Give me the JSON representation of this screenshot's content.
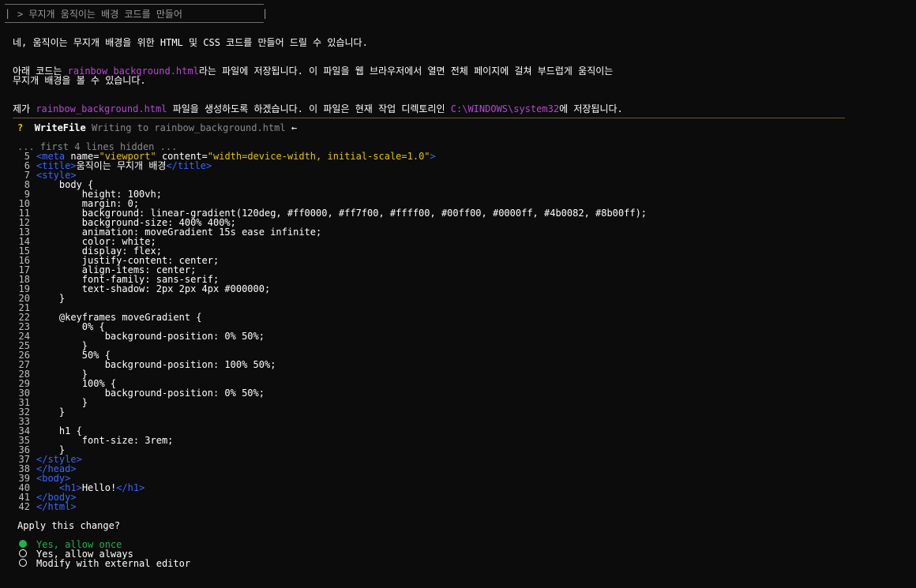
{
  "prompt": {
    "bar_left": "|",
    "text": "> 무지개 움직이는 배경 코드를 만들어",
    "bar_right": "|"
  },
  "messages": {
    "m1": "네, 움직이는 무지개 배경을 위한 HTML 및 CSS 코드를 만들어 드릴 수 있습니다.",
    "m2_pre": "아래 코드는 ",
    "m2_file": "rainbow_background.html",
    "m2_post": "라는 파일에 저장됩니다. 이 파일을 웹 브라우저에서 열면 전체 페이지에 걸쳐 부드럽게 움직이는",
    "m2_line2": "무지개 배경을 볼 수 있습니다.",
    "m3_pre": "제가 ",
    "m3_file": "rainbow_background.html",
    "m3_mid": " 파일을 생성하도록 하겠습니다. 이 파일은 현재 작업 디렉토리인 ",
    "m3_path": "C:\\WINDOWS\\system32",
    "m3_post": "에 저장됩니다."
  },
  "tool": {
    "q": "?",
    "name": "WriteFile",
    "desc": "Writing to rainbow_background.html",
    "arrow": "←"
  },
  "hidden_note": "... first 4 lines hidden ...",
  "code_lines": [
    {
      "n": "5",
      "segs": [
        [
          "tag",
          "<meta"
        ],
        [
          "attr",
          " name="
        ],
        [
          "str",
          "\"viewport\""
        ],
        [
          "attr",
          " content="
        ],
        [
          "str",
          "\"width=device-width, initial-scale=1.0\""
        ],
        [
          "tag",
          ">"
        ]
      ]
    },
    {
      "n": "6",
      "segs": [
        [
          "tag",
          "<title"
        ],
        [
          "tag",
          ">"
        ],
        [
          "text",
          "움직이는 무지개 배경"
        ],
        [
          "tag",
          "</title"
        ],
        [
          "tag",
          ">"
        ]
      ]
    },
    {
      "n": "7",
      "segs": [
        [
          "tag",
          "<style"
        ],
        [
          "tag",
          ">"
        ]
      ]
    },
    {
      "n": "8",
      "segs": [
        [
          "text",
          "    body {"
        ]
      ]
    },
    {
      "n": "9",
      "segs": [
        [
          "text",
          "        height: 100vh;"
        ]
      ]
    },
    {
      "n": "10",
      "segs": [
        [
          "text",
          "        margin: 0;"
        ]
      ]
    },
    {
      "n": "11",
      "segs": [
        [
          "text",
          "        background: linear-gradient(120deg, #ff0000, #ff7f00, #ffff00, #00ff00, #0000ff, #4b0082, #8b00ff);"
        ]
      ]
    },
    {
      "n": "12",
      "segs": [
        [
          "text",
          "        background-size: 400% 400%;"
        ]
      ]
    },
    {
      "n": "13",
      "segs": [
        [
          "text",
          "        animation: moveGradient 15s ease infinite;"
        ]
      ]
    },
    {
      "n": "14",
      "segs": [
        [
          "text",
          "        color: white;"
        ]
      ]
    },
    {
      "n": "15",
      "segs": [
        [
          "text",
          "        display: flex;"
        ]
      ]
    },
    {
      "n": "16",
      "segs": [
        [
          "text",
          "        justify-content: center;"
        ]
      ]
    },
    {
      "n": "17",
      "segs": [
        [
          "text",
          "        align-items: center;"
        ]
      ]
    },
    {
      "n": "18",
      "segs": [
        [
          "text",
          "        font-family: sans-serif;"
        ]
      ]
    },
    {
      "n": "19",
      "segs": [
        [
          "text",
          "        text-shadow: 2px 2px 4px #000000;"
        ]
      ]
    },
    {
      "n": "20",
      "segs": [
        [
          "text",
          "    }"
        ]
      ]
    },
    {
      "n": "21",
      "segs": []
    },
    {
      "n": "22",
      "segs": [
        [
          "text",
          "    @keyframes moveGradient {"
        ]
      ]
    },
    {
      "n": "23",
      "segs": [
        [
          "text",
          "        0% {"
        ]
      ]
    },
    {
      "n": "24",
      "segs": [
        [
          "text",
          "            background-position: 0% 50%;"
        ]
      ]
    },
    {
      "n": "25",
      "segs": [
        [
          "text",
          "        }"
        ]
      ]
    },
    {
      "n": "26",
      "segs": [
        [
          "text",
          "        50% {"
        ]
      ]
    },
    {
      "n": "27",
      "segs": [
        [
          "text",
          "            background-position: 100% 50%;"
        ]
      ]
    },
    {
      "n": "28",
      "segs": [
        [
          "text",
          "        }"
        ]
      ]
    },
    {
      "n": "29",
      "segs": [
        [
          "text",
          "        100% {"
        ]
      ]
    },
    {
      "n": "30",
      "segs": [
        [
          "text",
          "            background-position: 0% 50%;"
        ]
      ]
    },
    {
      "n": "31",
      "segs": [
        [
          "text",
          "        }"
        ]
      ]
    },
    {
      "n": "32",
      "segs": [
        [
          "text",
          "    }"
        ]
      ]
    },
    {
      "n": "33",
      "segs": []
    },
    {
      "n": "34",
      "segs": [
        [
          "text",
          "    h1 {"
        ]
      ]
    },
    {
      "n": "35",
      "segs": [
        [
          "text",
          "        font-size: 3rem;"
        ]
      ]
    },
    {
      "n": "36",
      "segs": [
        [
          "text",
          "    }"
        ]
      ]
    },
    {
      "n": "37",
      "segs": [
        [
          "tag",
          "</style"
        ],
        [
          "tag",
          ">"
        ]
      ]
    },
    {
      "n": "38",
      "segs": [
        [
          "tag",
          "</head"
        ],
        [
          "tag",
          ">"
        ]
      ]
    },
    {
      "n": "39",
      "segs": [
        [
          "tag",
          "<body"
        ],
        [
          "tag",
          ">"
        ]
      ]
    },
    {
      "n": "40",
      "segs": [
        [
          "text",
          "    "
        ],
        [
          "tag",
          "<h1"
        ],
        [
          "tag",
          ">"
        ],
        [
          "text",
          "Hello!"
        ],
        [
          "tag",
          "</h1"
        ],
        [
          "tag",
          ">"
        ]
      ]
    },
    {
      "n": "41",
      "segs": [
        [
          "tag",
          "</body"
        ],
        [
          "tag",
          ">"
        ]
      ]
    },
    {
      "n": "42",
      "segs": [
        [
          "tag",
          "</html"
        ],
        [
          "tag",
          ">"
        ]
      ]
    }
  ],
  "apply": {
    "question": "Apply this change?",
    "options": [
      {
        "label": "Yes, allow once",
        "selected": true
      },
      {
        "label": "Yes, allow always",
        "selected": false
      },
      {
        "label": "Modify with external editor",
        "selected": false
      }
    ]
  },
  "colors": {
    "background": "#0c0c0c",
    "highlight": "#b845d6",
    "tag": "#3a66ff",
    "string": "#e6c200",
    "selected": "#22b14c"
  }
}
